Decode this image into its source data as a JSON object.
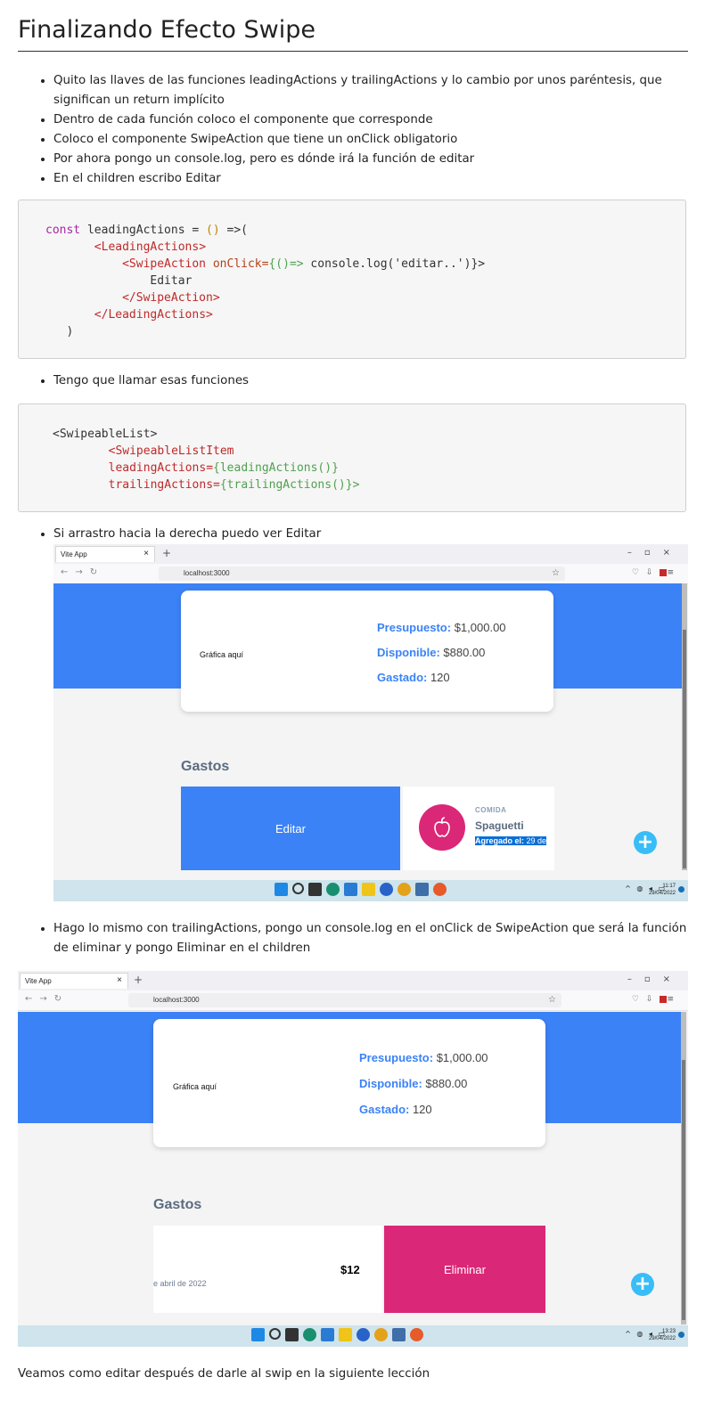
{
  "page": {
    "title": "Finalizando Efecto Swipe",
    "bullets_1": [
      "Quito las llaves de las funciones leadingActions y trailingActions y lo cambio por unos paréntesis, que significan un return implícito",
      "Dentro de cada función coloco el componente que corresponde",
      "Coloco el componente SwipeAction que tiene un onClick obligatorio",
      "Por ahora pongo un console.log, pero es dónde irá la función de editar",
      "En el children escribo Editar"
    ],
    "bullet_2": "Tengo que llamar esas funciones",
    "bullet_3": "Si arrastro hacia la derecha puedo ver Editar",
    "bullet_4": "Hago lo mismo con trailingActions, pongo un console.log en el onClick de SwipeAction que será la función de eliminar y pongo Eliminar en el children",
    "footer": "Veamos como editar después de darle al swip en la siguiente lección"
  },
  "code_1": {
    "const": "const",
    "fn_name": " leadingActions = ",
    "parens": "()",
    "arrow": " =>(",
    "open_leading": "<LeadingActions>",
    "open_swipe": "<SwipeAction",
    "onclick_attr": " onClick=",
    "onclick_val": "{()=>",
    "onclick_body": " console.log('editar..')}>",
    "children": "Editar",
    "close_swipe": "</SwipeAction>",
    "close_leading": "</LeadingActions>",
    "close_paren": ")"
  },
  "code_2": {
    "open_list": "<SwipeableList>",
    "open_item": "<SwipeableListItem",
    "leading_attr": "leadingActions=",
    "leading_val": "{leadingActions()}",
    "trailing_attr": "trailingActions=",
    "trailing_val": "{trailingActions()}>"
  },
  "shot_common": {
    "tab_title": "Vite App",
    "url": "localhost:3000",
    "chart_placeholder": "Gráfica aquí",
    "presupuesto_label": "Presupuesto:",
    "presupuesto_value": " $1,000.00",
    "disponible_label": "Disponible:",
    "disponible_value": " $880.00",
    "gastado_label": "Gastado:",
    "gastado_value": " 120",
    "gastos_heading": "Gastos",
    "fab": "+"
  },
  "shot_1": {
    "swipe_label": "Editar",
    "category": "COMIDA",
    "name": "Spaguetti",
    "date_label": "Agregado el:",
    "date_value": " 29 de",
    "clock_time": "11:17",
    "clock_date": "29/04/2022"
  },
  "shot_2": {
    "swipe_label": "Eliminar",
    "amount": "$12",
    "date_partial": "e abril de 2022",
    "clock_time": "13:23",
    "clock_date": "29/04/2022"
  },
  "colors": {
    "header_blue": "#3b82f6",
    "pink": "#db2777",
    "fab": "#38bdf8",
    "taskbar": "#cfe4ec"
  }
}
